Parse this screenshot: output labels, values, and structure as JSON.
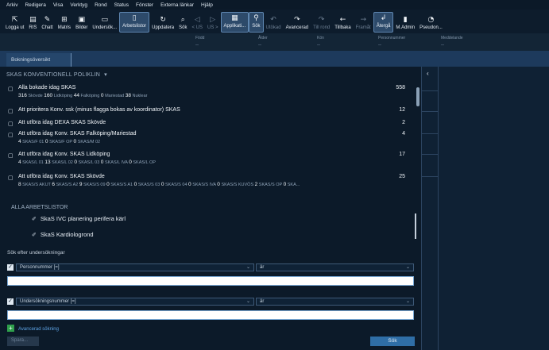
{
  "menu": [
    "Arkiv",
    "Redigera",
    "Visa",
    "Verktyg",
    "Rond",
    "Status",
    "Fönster",
    "Externa länkar",
    "Hjälp"
  ],
  "toolbar": [
    {
      "label": "Logga ut",
      "icon": "logout-icon",
      "glyph": "⇱",
      "state": "normal"
    },
    {
      "label": "RIS",
      "icon": "ris-icon",
      "glyph": "▤",
      "state": "normal"
    },
    {
      "label": "Chatt",
      "icon": "chat-icon",
      "glyph": "✎",
      "state": "normal"
    },
    {
      "label": "Matris",
      "icon": "matrix-icon",
      "glyph": "⊞",
      "state": "normal"
    },
    {
      "label": "Bilder",
      "icon": "images-icon",
      "glyph": "▣",
      "state": "normal"
    },
    {
      "label": "Undersök...",
      "icon": "examination-icon",
      "glyph": "▭",
      "state": "normal"
    },
    {
      "label": "Arbetslistor",
      "icon": "worklists-icon",
      "glyph": "▯",
      "state": "active"
    },
    {
      "label": "Uppdatera",
      "icon": "refresh-icon",
      "glyph": "↻",
      "state": "normal"
    },
    {
      "label": "Sök",
      "icon": "search-clock-icon",
      "glyph": "⌕",
      "state": "normal"
    },
    {
      "label": "< US",
      "icon": "prev-us-icon",
      "glyph": "◁",
      "state": "dim"
    },
    {
      "label": "US >",
      "icon": "next-us-icon",
      "glyph": "▷",
      "state": "dim"
    },
    {
      "label": "Applikati...",
      "icon": "applications-icon",
      "glyph": "▦",
      "state": "active"
    },
    {
      "label": "Sök",
      "icon": "search-icon",
      "glyph": "⚲",
      "state": "active"
    },
    {
      "label": "Utökad",
      "icon": "extended-icon",
      "glyph": "↶",
      "state": "dim"
    },
    {
      "label": "Avancerad",
      "icon": "advanced-icon",
      "glyph": "↷",
      "state": "normal"
    },
    {
      "label": "Till rond",
      "icon": "to-round-icon",
      "glyph": "↷",
      "state": "dim"
    },
    {
      "label": "Tillbaka",
      "icon": "back-icon",
      "glyph": "←",
      "state": "normal"
    },
    {
      "label": "Framåt",
      "icon": "forward-icon",
      "glyph": "→",
      "state": "dim"
    },
    {
      "label": "Återgå",
      "icon": "return-icon",
      "glyph": "↲",
      "state": "active"
    },
    {
      "label": "M.Admin",
      "icon": "admin-icon",
      "glyph": "▮",
      "state": "normal"
    },
    {
      "label": "Pseudon...",
      "icon": "pseudonym-icon",
      "glyph": "◔",
      "state": "normal"
    }
  ],
  "filters": [
    {
      "label": "Född",
      "value": "--"
    },
    {
      "label": "Ålder",
      "value": "--"
    },
    {
      "label": "Kön",
      "value": "--"
    },
    {
      "label": "Personnummer",
      "value": "--"
    },
    {
      "label": "Meddelande",
      "value": "--"
    }
  ],
  "tab": {
    "label": "Bokningsöversikt"
  },
  "overview": {
    "section_title": "SKAS KONVENTIONELL POLIKLIN",
    "section_arrow": "▾",
    "collapse_glyph": "‹",
    "rows": [
      {
        "title": "Alla bokade idag SKAS",
        "count": "558",
        "sub": [
          {
            "num": "316",
            "label": "Skövde"
          },
          {
            "num": "160",
            "label": "Lidköping"
          },
          {
            "num": "44",
            "label": "Falköping"
          },
          {
            "num": "0",
            "label": "Mariestad"
          },
          {
            "num": "38",
            "label": "Nuklear"
          }
        ]
      },
      {
        "title": "Att prioritera Konv. ssk (minus flagga bokas av koordinator) SKAS",
        "count": "12",
        "sub": []
      },
      {
        "title": "Att utföra idag DEXA SKAS Skövde",
        "count": "2",
        "sub": []
      },
      {
        "title": "Att utföra idag Konv. SKAS Falköping/Mariestad",
        "count": "4",
        "sub": [
          {
            "num": "4",
            "label": "SKAS/F 01"
          },
          {
            "num": "0",
            "label": "SKAS/F OP"
          },
          {
            "num": "0",
            "label": "SKAS/M 02"
          }
        ]
      },
      {
        "title": "Att utföra idag Konv. SKAS Lidköping",
        "count": "17",
        "sub": [
          {
            "num": "4",
            "label": "SKAS/L 01"
          },
          {
            "num": "13",
            "label": "SKAS/L 02"
          },
          {
            "num": "0",
            "label": "SKAS/L 03"
          },
          {
            "num": "0",
            "label": "SKAS/L IVA"
          },
          {
            "num": "0",
            "label": "SKAS/L OP"
          }
        ]
      },
      {
        "title": "Att utföra idag Konv. SKAS Skövde",
        "count": "25",
        "sub": [
          {
            "num": "8",
            "label": "SKAS/S AKUT"
          },
          {
            "num": "6",
            "label": "SKAS/S A2"
          },
          {
            "num": "9",
            "label": "SKAS/S 09"
          },
          {
            "num": "0",
            "label": "SKAS/S A1"
          },
          {
            "num": "0",
            "label": "SKAS/S 03"
          },
          {
            "num": "0",
            "label": "SKAS/S 04"
          },
          {
            "num": "0",
            "label": "SKAS/S IVA"
          },
          {
            "num": "0",
            "label": "SKAS/S KUVÖS"
          },
          {
            "num": "2",
            "label": "SKAS/S OP"
          },
          {
            "num": "0",
            "label": "SKA..."
          }
        ]
      }
    ]
  },
  "all_worklists": {
    "title": "ALLA ARBETSLISTOR",
    "items": [
      "SkaS IVC planering perifera kärl",
      "SkaS Kardiologrond"
    ]
  },
  "search": {
    "title": "Sök efter undersökningar",
    "field1": {
      "name": "Personnummer [=]",
      "operator": "är",
      "value": ""
    },
    "field2": {
      "name": "Undersökningsnummer [=]",
      "operator": "är",
      "value": ""
    },
    "advanced_label": "Avancerad sökning",
    "save_label": "Spara...",
    "search_label": "Sök"
  },
  "colors": {
    "background": "#0c1a29",
    "accent": "#2f6ea6",
    "link": "#5ea4e6",
    "add": "#2fa04c"
  }
}
